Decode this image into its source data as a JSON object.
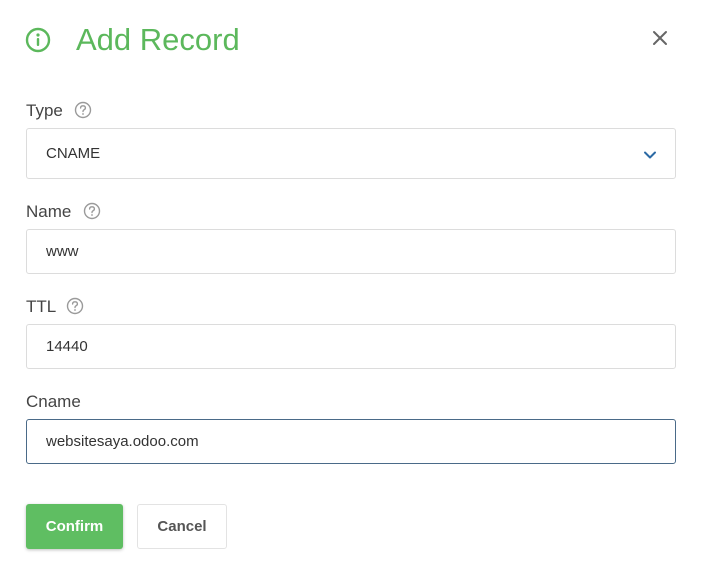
{
  "dialog": {
    "title": "Add Record",
    "header_icon": "info-circle-icon",
    "close_icon": "close-icon",
    "accent_color": "#5cb85c"
  },
  "fields": {
    "type": {
      "label": "Type",
      "value": "CNAME",
      "help_icon": "help-circle-icon",
      "dropdown_icon": "chevron-down-icon"
    },
    "name": {
      "label": "Name",
      "value": "www",
      "help_icon": "help-circle-icon"
    },
    "ttl": {
      "label": "TTL",
      "value": "14440",
      "help_icon": "help-circle-icon"
    },
    "cname": {
      "label": "Cname",
      "value": "websitesaya.odoo.com"
    }
  },
  "actions": {
    "confirm_label": "Confirm",
    "cancel_label": "Cancel",
    "confirm_color": "#5fbe62"
  }
}
